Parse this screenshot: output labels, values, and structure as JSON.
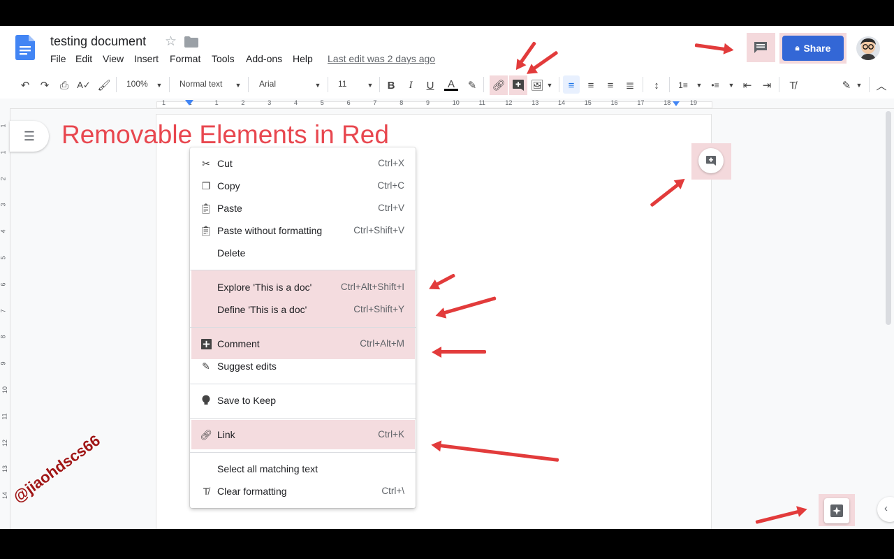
{
  "doc": {
    "title": "testing document",
    "last_edit": "Last edit was 2 days ago",
    "menu": [
      "File",
      "Edit",
      "View",
      "Insert",
      "Format",
      "Tools",
      "Add-ons",
      "Help"
    ],
    "share_label": "Share"
  },
  "toolbar": {
    "zoom": "100%",
    "style": "Normal text",
    "font": "Arial",
    "font_size": "11"
  },
  "ruler": {
    "ticks": [
      "1",
      "1",
      "1",
      "2",
      "3",
      "4",
      "5",
      "6",
      "7",
      "8",
      "9",
      "10",
      "11",
      "12",
      "13",
      "14",
      "15",
      "16",
      "17",
      "18",
      "19"
    ]
  },
  "vertical_ruler": {
    "ticks": [
      "1",
      "1",
      "2",
      "3",
      "4",
      "5",
      "6",
      "7",
      "8",
      "9",
      "10",
      "11",
      "12",
      "13",
      "14"
    ]
  },
  "annotation": {
    "heading": "Removable Elements in Red",
    "watermark": "@jiaohdscs66"
  },
  "context_menu": {
    "items": [
      {
        "icon": "scissors-icon",
        "label": "Cut",
        "shortcut": "Ctrl+X"
      },
      {
        "icon": "copy-icon",
        "label": "Copy",
        "shortcut": "Ctrl+C"
      },
      {
        "icon": "clipboard-icon",
        "label": "Paste",
        "shortcut": "Ctrl+V"
      },
      {
        "icon": "paste-plain-icon",
        "label": "Paste without formatting",
        "shortcut": "Ctrl+Shift+V"
      },
      {
        "icon": "",
        "label": "Delete",
        "shortcut": ""
      },
      {
        "icon": "",
        "label": "Explore 'This is a doc'",
        "shortcut": "Ctrl+Alt+Shift+I"
      },
      {
        "icon": "",
        "label": "Define 'This is a doc'",
        "shortcut": "Ctrl+Shift+Y"
      },
      {
        "icon": "add-comment-icon",
        "label": "Comment",
        "shortcut": "Ctrl+Alt+M"
      },
      {
        "icon": "suggest-edits-icon",
        "label": "Suggest edits",
        "shortcut": ""
      },
      {
        "icon": "lightbulb-icon",
        "label": "Save to Keep",
        "shortcut": ""
      },
      {
        "icon": "link-icon",
        "label": "Link",
        "shortcut": "Ctrl+K"
      },
      {
        "icon": "",
        "label": "Select all matching text",
        "shortcut": ""
      },
      {
        "icon": "clear-format-icon",
        "label": "Clear formatting",
        "shortcut": "Ctrl+\\"
      }
    ]
  },
  "colors": {
    "accent": "#3367d6",
    "highlight": "#f4d9dc",
    "arrow": "#e23b3b",
    "annotation_text": "#e8474f"
  }
}
